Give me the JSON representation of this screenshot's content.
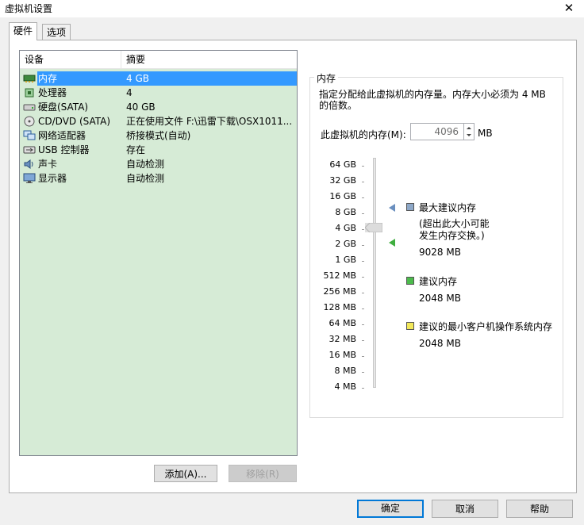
{
  "window": {
    "title": "虚拟机设置",
    "close_glyph": "✕"
  },
  "tabs": [
    {
      "label": "硬件",
      "active": true
    },
    {
      "label": "选项",
      "active": false
    }
  ],
  "device_list": {
    "columns": [
      "设备",
      "摘要"
    ],
    "rows": [
      {
        "name": "内存",
        "summary": "4 GB",
        "icon": "memory-icon",
        "selected": true
      },
      {
        "name": "处理器",
        "summary": "4",
        "icon": "processor-icon",
        "selected": false
      },
      {
        "name": "硬盘(SATA)",
        "summary": "40 GB",
        "icon": "hard-disk-icon",
        "selected": false
      },
      {
        "name": "CD/DVD (SATA)",
        "summary": "正在使用文件 F:\\迅雷下载\\OSX1011...",
        "icon": "cd-dvd-icon",
        "selected": false
      },
      {
        "name": "网络适配器",
        "summary": "桥接模式(自动)",
        "icon": "network-adapter-icon",
        "selected": false
      },
      {
        "name": "USB 控制器",
        "summary": "存在",
        "icon": "usb-icon",
        "selected": false
      },
      {
        "name": "声卡",
        "summary": "自动检测",
        "icon": "sound-card-icon",
        "selected": false
      },
      {
        "name": "显示器",
        "summary": "自动检测",
        "icon": "display-icon",
        "selected": false
      }
    ]
  },
  "list_buttons": {
    "add": "添加(A)...",
    "remove": "移除(R)"
  },
  "memory": {
    "group_title": "内存",
    "description": "指定分配给此虚拟机的内存量。内存大小必须为 4 MB 的倍数。",
    "label": "此虚拟机的内存(M):",
    "value": "4096",
    "unit": "MB",
    "scale_labels": [
      "64 GB",
      "32 GB",
      "16 GB",
      "8 GB",
      "4 GB",
      "2 GB",
      "1 GB",
      "512 MB",
      "256 MB",
      "128 MB",
      "64 MB",
      "32 MB",
      "16 MB",
      "8 MB",
      "4 MB"
    ],
    "legend": {
      "max": {
        "title": "最大建议内存",
        "note_line1": "(超出此大小可能",
        "note_line2": "发生内存交换。)",
        "value": "9028 MB",
        "color": "#8ea8c8"
      },
      "recommended": {
        "title": "建议内存",
        "value": "2048 MB",
        "color": "#4cbb4c"
      },
      "min_guest": {
        "title": "建议的最小客户机操作系统内存",
        "value": "2048 MB",
        "color": "#f2e85a"
      }
    }
  },
  "dialog_buttons": {
    "ok": "确定",
    "cancel": "取消",
    "help": "帮助"
  }
}
